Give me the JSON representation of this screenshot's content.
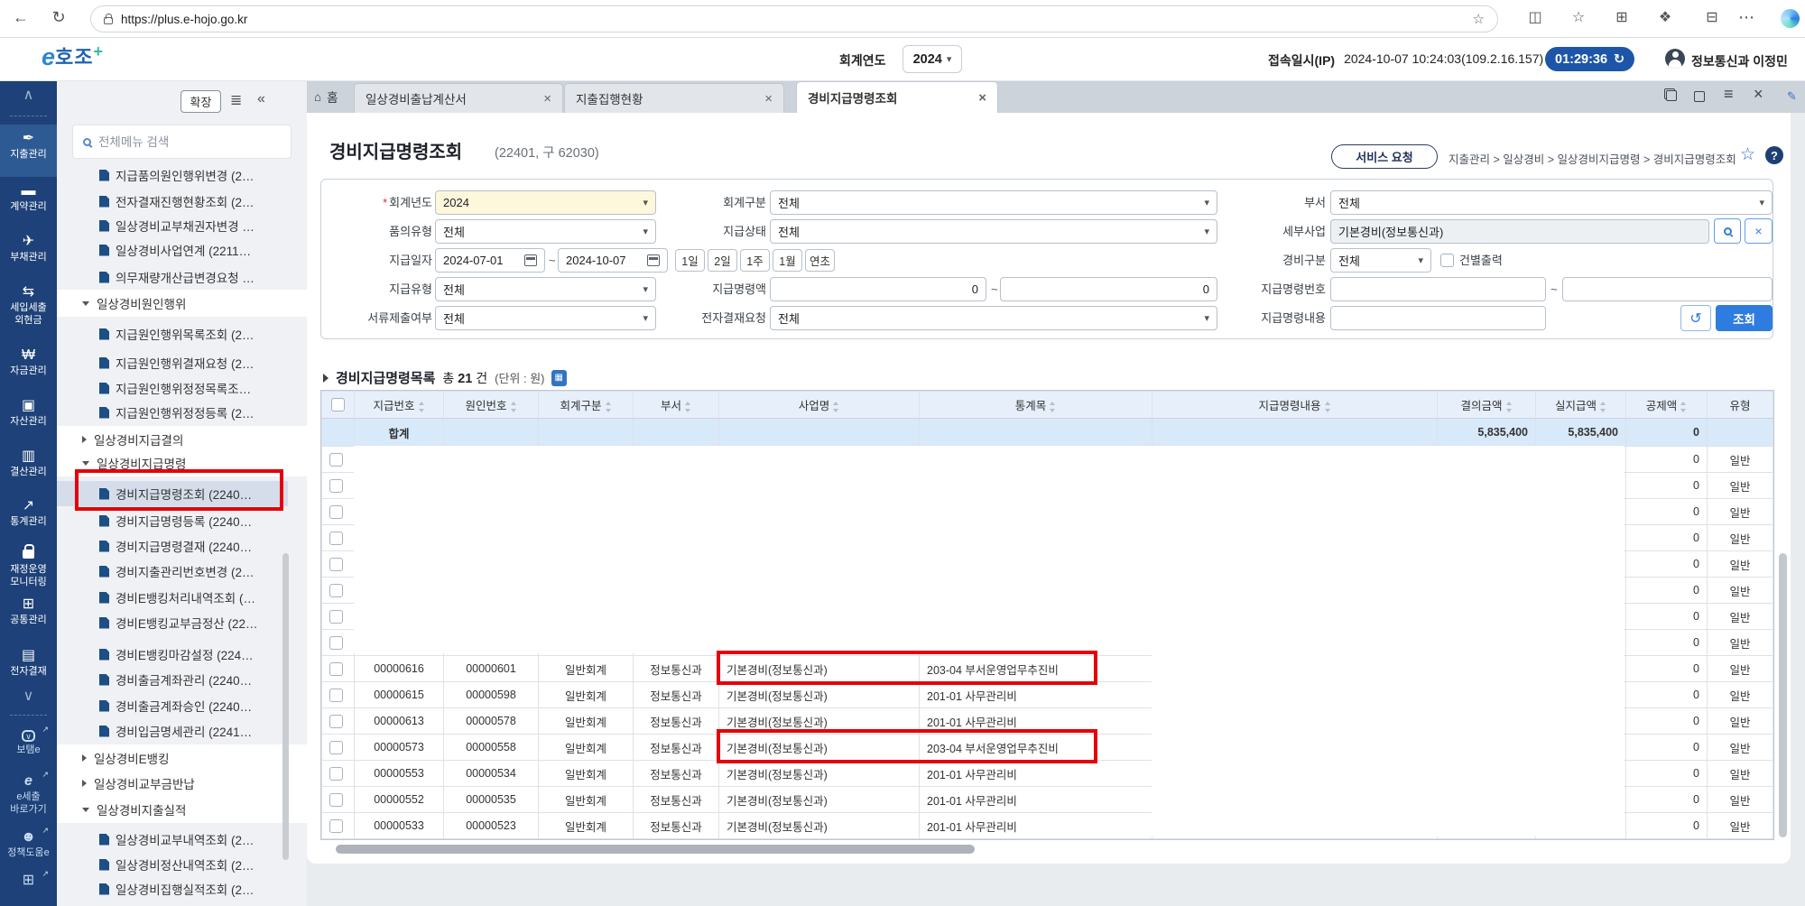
{
  "browser": {
    "url": "https://plus.e-hojo.go.kr"
  },
  "header": {
    "logo_e": "e",
    "logo_text": "호조",
    "logo_plus": "+",
    "year_label": "회계연도",
    "year_value": "2024",
    "session_label": "접속일시(IP)",
    "session_value": "2024-10-07 10:24:03(109.2.16.157)",
    "timer": "01:29:36",
    "user": "정보통신과 이정민"
  },
  "rail": {
    "items": [
      {
        "label": "지출관리"
      },
      {
        "label": "계약관리"
      },
      {
        "label": "부채관리"
      },
      {
        "label": "세입세출",
        "label2": "외현금"
      },
      {
        "label": "자금관리"
      },
      {
        "label": "자산관리"
      },
      {
        "label": "결산관리"
      },
      {
        "label": "통계관리"
      },
      {
        "label": "재정운영",
        "label2": "모니터링"
      },
      {
        "label": "공통관리"
      },
      {
        "label": "전자결재"
      }
    ],
    "links": [
      {
        "label": "보탬e"
      },
      {
        "label": "e세출",
        "label2": "바로가기"
      },
      {
        "label": "정책도움e"
      }
    ]
  },
  "tree": {
    "expand_button": "확장",
    "search_placeholder": "전체메뉴 검색",
    "items": [
      {
        "label": "지급품의원인행위변경 (2…"
      },
      {
        "label": "전자결재진행현황조회 (2…"
      },
      {
        "label": "일상경비교부채권자변경 …"
      },
      {
        "label": "일상경비사업연계 (2211…"
      },
      {
        "label": "의무재량개산급변경요청 …"
      },
      {
        "label": "일상경비원인행위"
      },
      {
        "label": "지급원인행위목록조회 (2…"
      },
      {
        "label": "지급원인행위결재요청 (2…"
      },
      {
        "label": "지급원인행위정정목록조…"
      },
      {
        "label": "지급원인행위정정등록 (2…"
      },
      {
        "label": "일상경비지급결의"
      },
      {
        "label": "일상경비지급명령"
      },
      {
        "label": "경비지급명령조회 (2240…"
      },
      {
        "label": "경비지급명령등록 (2240…"
      },
      {
        "label": "경비지급명령결재 (2240…"
      },
      {
        "label": "경비지출관리번호변경 (2…"
      },
      {
        "label": "경비E뱅킹처리내역조회 (…"
      },
      {
        "label": "경비E뱅킹교부금정산 (22…"
      },
      {
        "label": "경비E뱅킹마감설정 (224…"
      },
      {
        "label": "경비출금계좌관리 (2240…"
      },
      {
        "label": "경비출금계좌승인 (2240…"
      },
      {
        "label": "경비입금명세관리 (2241…"
      },
      {
        "label": "일상경비E뱅킹"
      },
      {
        "label": "일상경비교부금반납"
      },
      {
        "label": "일상경비지출실적"
      },
      {
        "label": "일상경비교부내역조회 (2…"
      },
      {
        "label": "일상경비정산내역조회 (2…"
      },
      {
        "label": "일상경비집행실적조회 (2…"
      }
    ]
  },
  "tabs": {
    "home": "홈",
    "items": [
      {
        "label": "일상경비출납계산서"
      },
      {
        "label": "지출집행현황"
      },
      {
        "label": "경비지급명령조회"
      }
    ]
  },
  "page": {
    "title": "경비지급명령조회",
    "code": "(22401, 구 62030)",
    "service_button": "서비스 요청",
    "breadcrumb": "지출관리 > 일상경비 > 일상경비지급명령 > 경비지급명령조회"
  },
  "filters": {
    "required_mark": "*",
    "tilde": "~",
    "fiscal_year": {
      "label": "회계년도",
      "value": "2024"
    },
    "acct_div": {
      "label": "회계구분",
      "value": "전체"
    },
    "dept": {
      "label": "부서",
      "value": "전체"
    },
    "request_type": {
      "label": "품의유형",
      "value": "전체"
    },
    "pay_status": {
      "label": "지급상태",
      "value": "전체"
    },
    "sub_biz": {
      "label": "세부사업",
      "value": "기본경비(정보통신과)"
    },
    "pay_date": {
      "label": "지급일자",
      "from": "2024-07-01",
      "to": "2024-10-07",
      "quick": [
        "1일",
        "2일",
        "1주",
        "1월",
        "연초"
      ]
    },
    "expense_div": {
      "label": "경비구분",
      "value": "전체",
      "checkbox": "건별출력"
    },
    "pay_type": {
      "label": "지급유형",
      "value": "전체"
    },
    "order_amt": {
      "label": "지급명령액",
      "from": "0",
      "to": "0"
    },
    "order_no": {
      "label": "지급명령번호",
      "from": "",
      "to": ""
    },
    "doc_submit": {
      "label": "서류제출여부",
      "value": "전체"
    },
    "edoc_req": {
      "label": "전자결재요청",
      "value": "전체"
    },
    "order_content": {
      "label": "지급명령내용",
      "value": ""
    },
    "search_button": "조회"
  },
  "list": {
    "title": "경비지급명령목록",
    "total_label": "총",
    "total_count": "21",
    "total_unit": "건",
    "unit_note": "(단위 : 원)",
    "columns": [
      "지급번호",
      "원인번호",
      "회계구분",
      "부서",
      "사업명",
      "통계목",
      "지급명령내용",
      "결의금액",
      "실지급액",
      "공제액",
      "유형"
    ],
    "sum": {
      "label": "합계",
      "amt1": "5,835,400",
      "amt2": "5,835,400",
      "ded": "0"
    },
    "rows": [
      {
        "pay": "",
        "cause": "",
        "acct": "",
        "dept": "",
        "biz": "",
        "stat": "",
        "content": "",
        "amt1": "",
        "amt2": "",
        "ded": "0",
        "type": "일반"
      },
      {
        "pay": "",
        "cause": "",
        "acct": "",
        "dept": "",
        "biz": "",
        "stat": "",
        "content": "",
        "amt1": "",
        "amt2": "",
        "ded": "0",
        "type": "일반"
      },
      {
        "pay": "",
        "cause": "",
        "acct": "",
        "dept": "",
        "biz": "",
        "stat": "",
        "content": "",
        "amt1": "",
        "amt2": "",
        "ded": "0",
        "type": "일반"
      },
      {
        "pay": "",
        "cause": "",
        "acct": "",
        "dept": "",
        "biz": "",
        "stat": "",
        "content": "",
        "amt1": "",
        "amt2": "",
        "ded": "0",
        "type": "일반"
      },
      {
        "pay": "",
        "cause": "",
        "acct": "",
        "dept": "",
        "biz": "",
        "stat": "",
        "content": "",
        "amt1": "",
        "amt2": "",
        "ded": "0",
        "type": "일반"
      },
      {
        "pay": "",
        "cause": "",
        "acct": "",
        "dept": "",
        "biz": "",
        "stat": "",
        "content": "",
        "amt1": "",
        "amt2": "",
        "ded": "0",
        "type": "일반"
      },
      {
        "pay": "",
        "cause": "",
        "acct": "",
        "dept": "",
        "biz": "",
        "stat": "",
        "content": "",
        "amt1": "",
        "amt2": "",
        "ded": "0",
        "type": "일반"
      },
      {
        "pay": "",
        "cause": "",
        "acct": "",
        "dept": "",
        "biz": "",
        "stat": "",
        "content": "",
        "amt1": "",
        "amt2": "",
        "ded": "0",
        "type": "일반"
      },
      {
        "pay": "00000616",
        "cause": "00000601",
        "acct": "일반회계",
        "dept": "정보통신과",
        "biz": "기본경비(정보통신과)",
        "stat": "203-04 부서운영업무추진비",
        "content": "",
        "amt1": "",
        "amt2": "",
        "ded": "0",
        "type": "일반"
      },
      {
        "pay": "00000615",
        "cause": "00000598",
        "acct": "일반회계",
        "dept": "정보통신과",
        "biz": "기본경비(정보통신과)",
        "stat": "201-01 사무관리비",
        "content": "",
        "amt1": "",
        "amt2": "",
        "ded": "0",
        "type": "일반"
      },
      {
        "pay": "00000613",
        "cause": "00000578",
        "acct": "일반회계",
        "dept": "정보통신과",
        "biz": "기본경비(정보통신과)",
        "stat": "201-01 사무관리비",
        "content": "",
        "amt1": "",
        "amt2": "",
        "ded": "0",
        "type": "일반"
      },
      {
        "pay": "00000573",
        "cause": "00000558",
        "acct": "일반회계",
        "dept": "정보통신과",
        "biz": "기본경비(정보통신과)",
        "stat": "203-04 부서운영업무추진비",
        "content": "",
        "amt1": "",
        "amt2": "",
        "ded": "0",
        "type": "일반"
      },
      {
        "pay": "00000553",
        "cause": "00000534",
        "acct": "일반회계",
        "dept": "정보통신과",
        "biz": "기본경비(정보통신과)",
        "stat": "201-01 사무관리비",
        "content": "",
        "amt1": "",
        "amt2": "",
        "ded": "0",
        "type": "일반"
      },
      {
        "pay": "00000552",
        "cause": "00000535",
        "acct": "일반회계",
        "dept": "정보통신과",
        "biz": "기본경비(정보통신과)",
        "stat": "201-01 사무관리비",
        "content": "",
        "amt1": "",
        "amt2": "",
        "ded": "0",
        "type": "일반"
      },
      {
        "pay": "00000533",
        "cause": "00000523",
        "acct": "일반회계",
        "dept": "정보통신과",
        "biz": "기본경비(정보통신과)",
        "stat": "201-01 사무관리비",
        "content": "",
        "amt1": "",
        "amt2": "",
        "ded": "0",
        "type": "일반"
      }
    ]
  }
}
